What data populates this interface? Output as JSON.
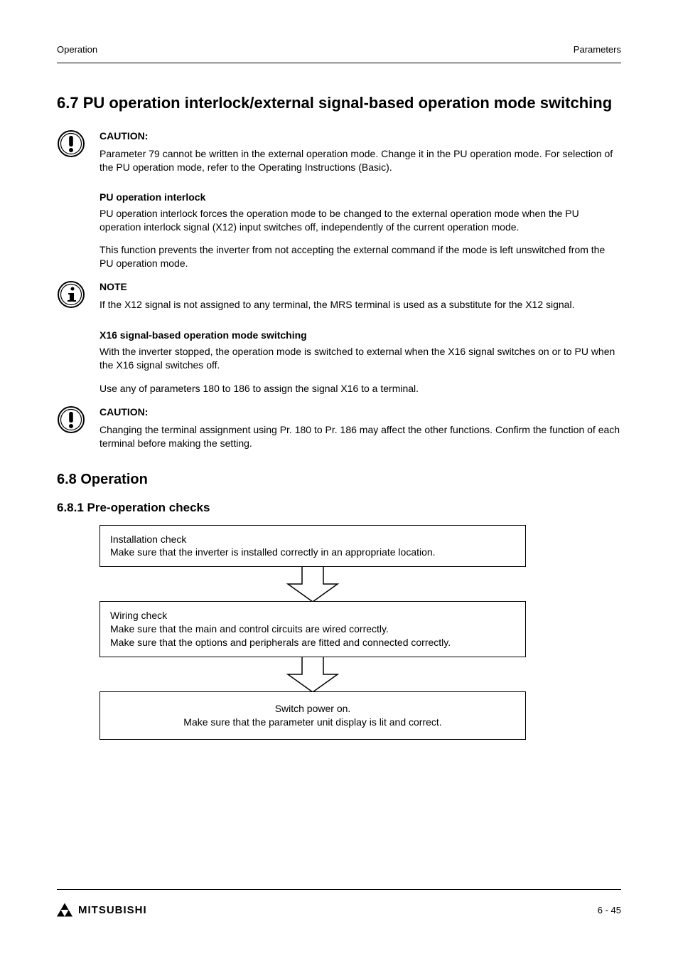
{
  "header": {
    "left": "Operation",
    "right": "Parameters"
  },
  "section": {
    "title": "6.7 PU operation interlock/external signal-based operation mode switching"
  },
  "caution1": {
    "label": "CAUTION:",
    "text": "Parameter 79 cannot be written in the external operation mode. Change it in the PU operation mode. For selection of the PU operation mode, refer to the Operating Instructions (Basic)."
  },
  "pu_interlock": {
    "heading": "PU operation interlock",
    "p1": "PU operation interlock forces the operation mode to be changed to the external operation mode when the PU operation interlock signal (X12) input switches off, independently of the current operation mode.",
    "p2": "This function prevents the inverter from not accepting the external command if the mode is left unswitched from the PU operation mode."
  },
  "note": {
    "label": "NOTE",
    "text": "If the X12 signal is not assigned to any terminal, the MRS terminal is used as a substitute for the X12 signal."
  },
  "ext_switch": {
    "heading": "X16 signal-based operation mode switching",
    "p1": "With the inverter stopped, the operation mode is switched to external when the X16 signal switches on or to PU when the X16 signal switches off.",
    "p2": "Use any of parameters 180 to 186 to assign the signal X16 to a terminal."
  },
  "caution2": {
    "label": "CAUTION:",
    "text": "Changing the terminal assignment using Pr. 180 to Pr. 186 may affect the other functions. Confirm the function of each terminal before making the setting."
  },
  "section2": {
    "title": "6.8 Operation",
    "sub": "6.8.1 Pre-operation checks"
  },
  "flow": {
    "step1": "Installation check\nMake sure that the inverter is installed correctly in an appropriate location.",
    "step2": "Wiring check\nMake sure that the main and control circuits are wired correctly.\nMake sure that the options and peripherals are fitted and connected correctly.",
    "step3": "Switch power on.\nMake sure that the parameter unit display is lit and correct."
  },
  "footer": {
    "brand": "MITSUBISHI",
    "page": "6 - 45"
  }
}
